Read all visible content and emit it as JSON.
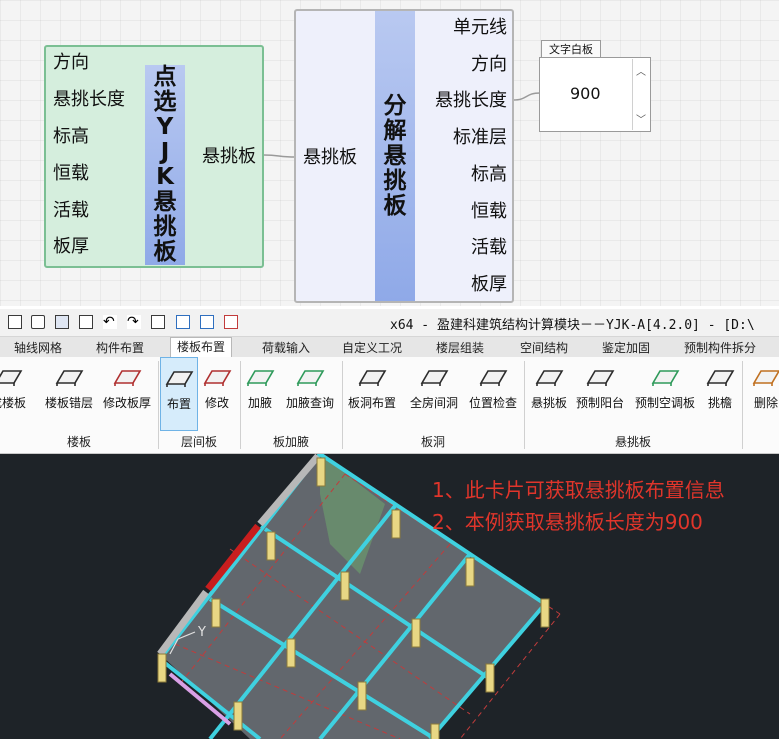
{
  "node_pick": {
    "inputs": [
      "方向",
      "悬挑长度",
      "标高",
      "恒载",
      "活载",
      "板厚"
    ],
    "title_chars": [
      "点",
      "选",
      "Y",
      "J",
      "K",
      "悬",
      "挑",
      "板"
    ],
    "output": "悬挑板"
  },
  "node_decompose": {
    "input": "悬挑板",
    "title_chars": [
      "分",
      "解",
      "悬",
      "挑",
      "板"
    ],
    "outputs": [
      "单元线",
      "方向",
      "悬挑长度",
      "标准层",
      "标高",
      "恒载",
      "活载",
      "板厚"
    ]
  },
  "text_panel": {
    "header": "文字白板",
    "value": "900"
  },
  "window": {
    "title": "x64 - 盈建科建筑结构计算模块－－YJK-A[4.2.0] - [D:\\"
  },
  "tabs": [
    {
      "label": "轴线网格",
      "active": false
    },
    {
      "label": "构件布置",
      "active": false
    },
    {
      "label": "楼板布置",
      "active": true
    },
    {
      "label": "荷载输入",
      "active": false
    },
    {
      "label": "自定义工况",
      "active": false
    },
    {
      "label": "楼层组装",
      "active": false
    },
    {
      "label": "空间结构",
      "active": false
    },
    {
      "label": "鉴定加固",
      "active": false
    },
    {
      "label": "预制构件拆分",
      "active": false
    }
  ],
  "tools": [
    {
      "label": "成楼板",
      "selected": false
    },
    {
      "label": "楼板错层",
      "selected": false
    },
    {
      "label": "修改板厚",
      "selected": false
    },
    {
      "label": "布置",
      "selected": true
    },
    {
      "label": "修改",
      "selected": false
    },
    {
      "label": "加腋",
      "selected": false
    },
    {
      "label": "加腋查询",
      "selected": false
    },
    {
      "label": "板洞布置",
      "selected": false
    },
    {
      "label": "全房间洞",
      "selected": false
    },
    {
      "label": "位置检查",
      "selected": false
    },
    {
      "label": "悬挑板",
      "selected": false
    },
    {
      "label": "预制阳台",
      "selected": false
    },
    {
      "label": "预制空调板",
      "selected": false
    },
    {
      "label": "挑檐",
      "selected": false
    },
    {
      "label": "删除",
      "selected": false
    }
  ],
  "groups": [
    "楼板",
    "层间板",
    "板加腋",
    "板洞",
    "悬挑板"
  ],
  "notes": [
    "1、此卡片可获取悬挑板布置信息",
    "2、本例获取悬挑板长度为900"
  ],
  "colors": {
    "node_green": "#d5eedd",
    "node_green_border": "#7bbf93",
    "node_blue": "#eef0fb",
    "title_blue": "#8fa9e8",
    "note_red": "#e0352b",
    "beam_cyan": "#3fd1e0"
  }
}
